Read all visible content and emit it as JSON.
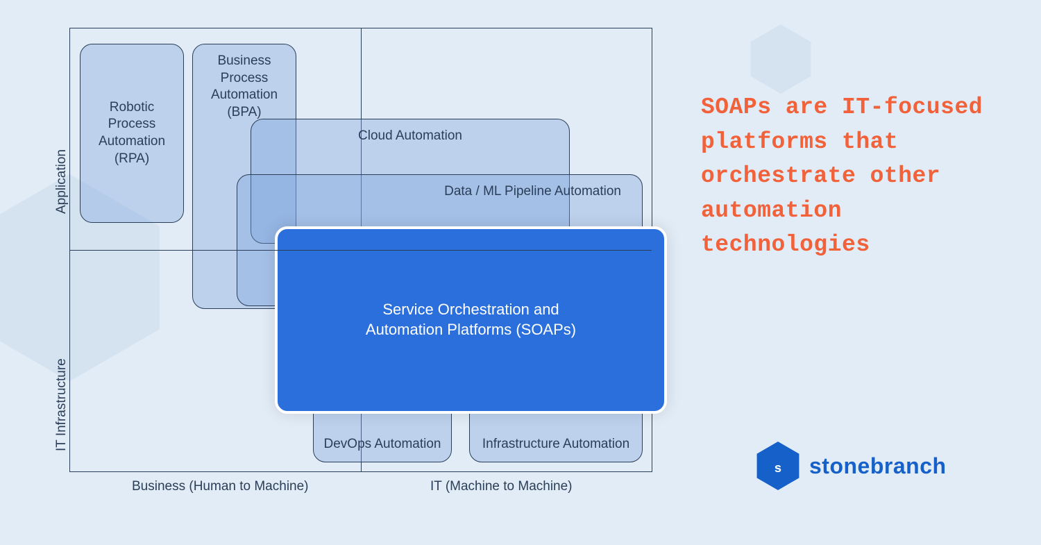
{
  "axes": {
    "y_top": "Application",
    "y_bottom": "IT Infrastructure",
    "x_left": "Business (Human to Machine)",
    "x_right": "IT (Machine to Machine)"
  },
  "boxes": {
    "rpa": "Robotic Process Automation (RPA)",
    "bpa": "Business Process Automation (BPA)",
    "cloud": "Cloud Automation",
    "dataml": "Data / ML Pipeline Automation",
    "soap": "Service Orchestration and Automation Platforms (SOAPs)",
    "devops": "DevOps Automation",
    "infra": "Infrastructure Automation"
  },
  "headline": "SOAPs are IT-focused platforms that orchestrate other automation technologies",
  "brand": {
    "letter": "s",
    "name": "stonebranch"
  },
  "colors": {
    "accent": "#f1613a",
    "brand_blue": "#1660c9",
    "soap_blue": "#2a6fdc",
    "ink": "#2b3e57"
  }
}
